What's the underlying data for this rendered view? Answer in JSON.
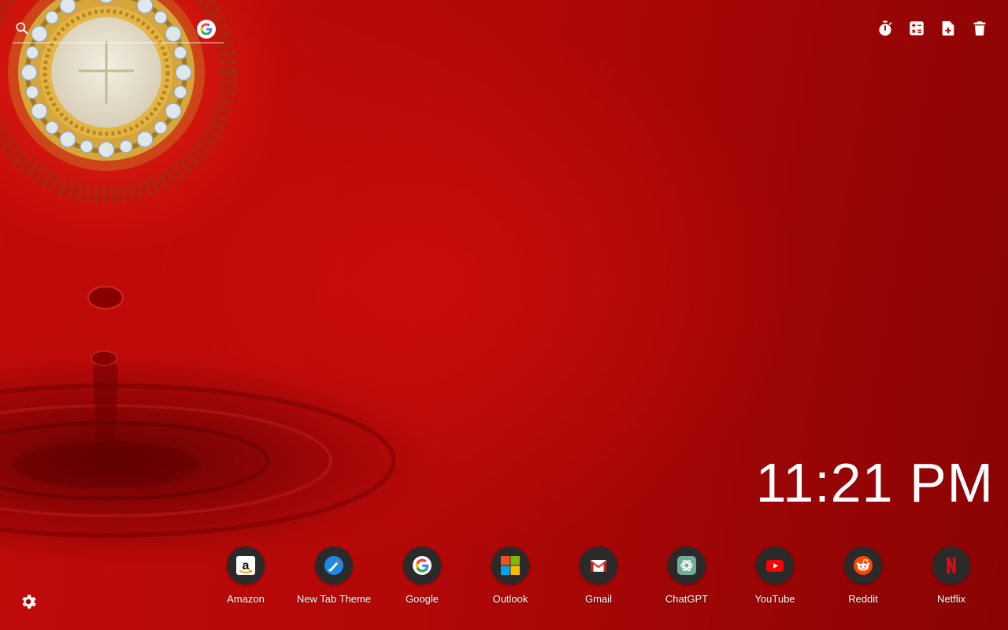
{
  "search": {
    "value": "",
    "placeholder": "",
    "engine_icon": "google-g-icon"
  },
  "toolbar": {
    "tools": [
      {
        "icon": "timer-icon"
      },
      {
        "icon": "calculator-icon"
      },
      {
        "icon": "add-note-icon"
      },
      {
        "icon": "trash-icon"
      }
    ]
  },
  "clock": {
    "time": "11:21 PM"
  },
  "shortcuts": [
    {
      "label": "Amazon",
      "icon": "amazon-icon"
    },
    {
      "label": "New Tab Theme",
      "icon": "new-tab-theme-icon"
    },
    {
      "label": "Google",
      "icon": "google-icon"
    },
    {
      "label": "Outlook",
      "icon": "outlook-icon"
    },
    {
      "label": "Gmail",
      "icon": "gmail-icon"
    },
    {
      "label": "ChatGPT",
      "icon": "chatgpt-icon"
    },
    {
      "label": "YouTube",
      "icon": "youtube-icon"
    },
    {
      "label": "Reddit",
      "icon": "reddit-icon"
    },
    {
      "label": "Netflix",
      "icon": "netflix-icon"
    }
  ],
  "settings": {
    "icon": "gear-icon"
  },
  "colors": {
    "background": "#b30808",
    "dock_circle": "#2a2a2a",
    "text": "#ffffff"
  }
}
